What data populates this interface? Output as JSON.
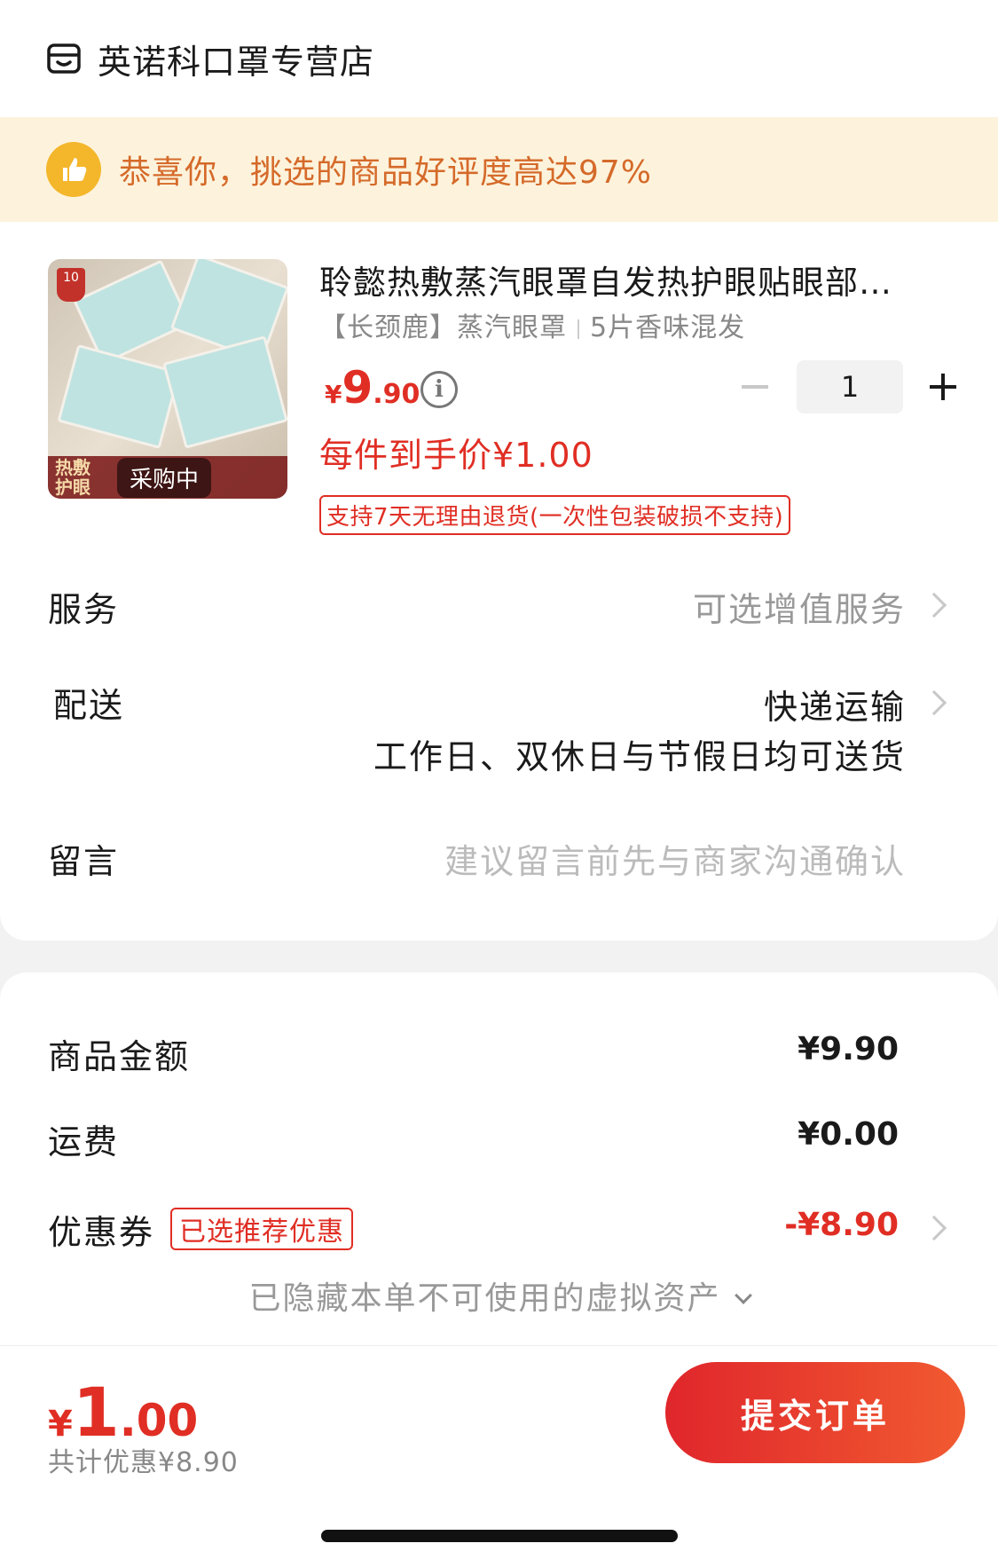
{
  "shop": {
    "icon": "store-icon",
    "name": "英诺科口罩专营店"
  },
  "praise": {
    "icon": "thumbs-up-icon",
    "text": "恭喜你，挑选的商品好评度高达97%"
  },
  "product": {
    "image_icon": "product-thumbnail",
    "image_badge": "10",
    "image_overlay_left": "热敷\n护眼",
    "image_tag": "采购中",
    "title": "聆懿热敷蒸汽眼罩自发热护眼贴眼部…",
    "spec_brand": "【长颈鹿】蒸汽眼罩",
    "spec_variant": "5片香味混发",
    "price_symbol": "¥",
    "price_int": "9",
    "price_dec": ".90",
    "quantity": "1",
    "unit_price": "每件到手价¥1.00",
    "return_policy": "支持7天无理由退货(一次性包装破损不支持)"
  },
  "rows": {
    "service_label": "服务",
    "service_value": "可选增值服务",
    "delivery_label": "配送",
    "delivery_value": "快递运输",
    "delivery_note": "工作日、双休日与节假日均可送货",
    "message_label": "留言",
    "message_placeholder": "建议留言前先与商家沟通确认"
  },
  "summary": {
    "goods_label": "商品金额",
    "goods_value": "¥9.90",
    "shipping_label": "运费",
    "shipping_value": "¥0.00",
    "coupon_label": "优惠券",
    "coupon_tag": "已选推荐优惠",
    "coupon_value": "-¥8.90",
    "hidden_assets": "已隐藏本单不可使用的虚拟资产"
  },
  "footer": {
    "total_symbol": "¥",
    "total_int": "1",
    "total_dec": ".00",
    "total_discount": "共计优惠¥8.90",
    "submit_label": "提交订单"
  },
  "colors": {
    "accent": "#e02e24",
    "praise_bg": "#fdf3dc",
    "praise_text": "#d56a2a"
  }
}
